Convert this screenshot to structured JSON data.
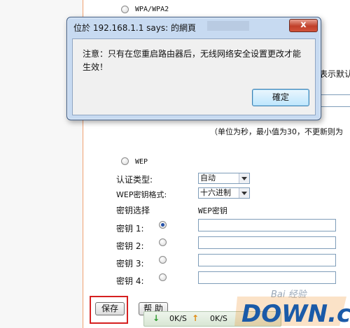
{
  "page": {
    "wpa_label": "WPA/WPA2",
    "right_hint_1": "表示默认",
    "right_hint_2": "（单位为秒，最小值为30，不更新则为",
    "wep_label": "WEP",
    "auth_type_label": "认证类型:",
    "auth_type_value": "自动",
    "wep_format_label": "WEP密钥格式:",
    "wep_format_value": "十六进制",
    "key_select_label": "密钥选择",
    "wep_key_header": "WEP密钥",
    "keys": [
      {
        "label": "密钥 1:",
        "checked": true
      },
      {
        "label": "密钥 2:",
        "checked": false
      },
      {
        "label": "密钥 3:",
        "checked": false
      },
      {
        "label": "密钥 4:",
        "checked": false
      }
    ],
    "save_label": "保存",
    "help_label": "帮 助"
  },
  "dialog": {
    "title": "位於 192.168.1.1 says: 的網頁",
    "close_glyph": "x",
    "message_line1": "注意：只有在您重启路由器后，无线网络安全设置更改才能",
    "message_line2": "生效！",
    "ok_label": "確定"
  },
  "statusbar": {
    "down_speed": "0K/S",
    "up_speed": "0K/S"
  },
  "watermark": {
    "text": "DOWN.cc",
    "baidu_text": "Bai 经验"
  },
  "colors": {
    "frame_accent": "#f0a070",
    "dialog_frame": "#c7daf1",
    "close_button": "#c0402a",
    "highlight_red": "#d62020",
    "watermark_blue": "#1a5aa8",
    "watermark_orange": "#f08a1e"
  }
}
